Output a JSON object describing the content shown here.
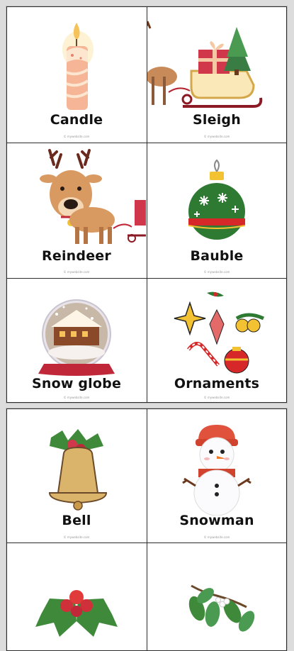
{
  "sheet1": {
    "cards": [
      {
        "label": "Candle"
      },
      {
        "label": "Sleigh"
      },
      {
        "label": "Reindeer"
      },
      {
        "label": "Bauble"
      },
      {
        "label": "Snow globe"
      },
      {
        "label": "Ornaments"
      }
    ]
  },
  "sheet2": {
    "cards": [
      {
        "label": "Bell"
      },
      {
        "label": "Snowman"
      },
      {
        "label": ""
      },
      {
        "label": ""
      }
    ]
  },
  "credit": "© mywebsite.com",
  "colors": {
    "border": "#2b2b2b",
    "page_bg": "#dcdcdc",
    "label": "#111111"
  }
}
